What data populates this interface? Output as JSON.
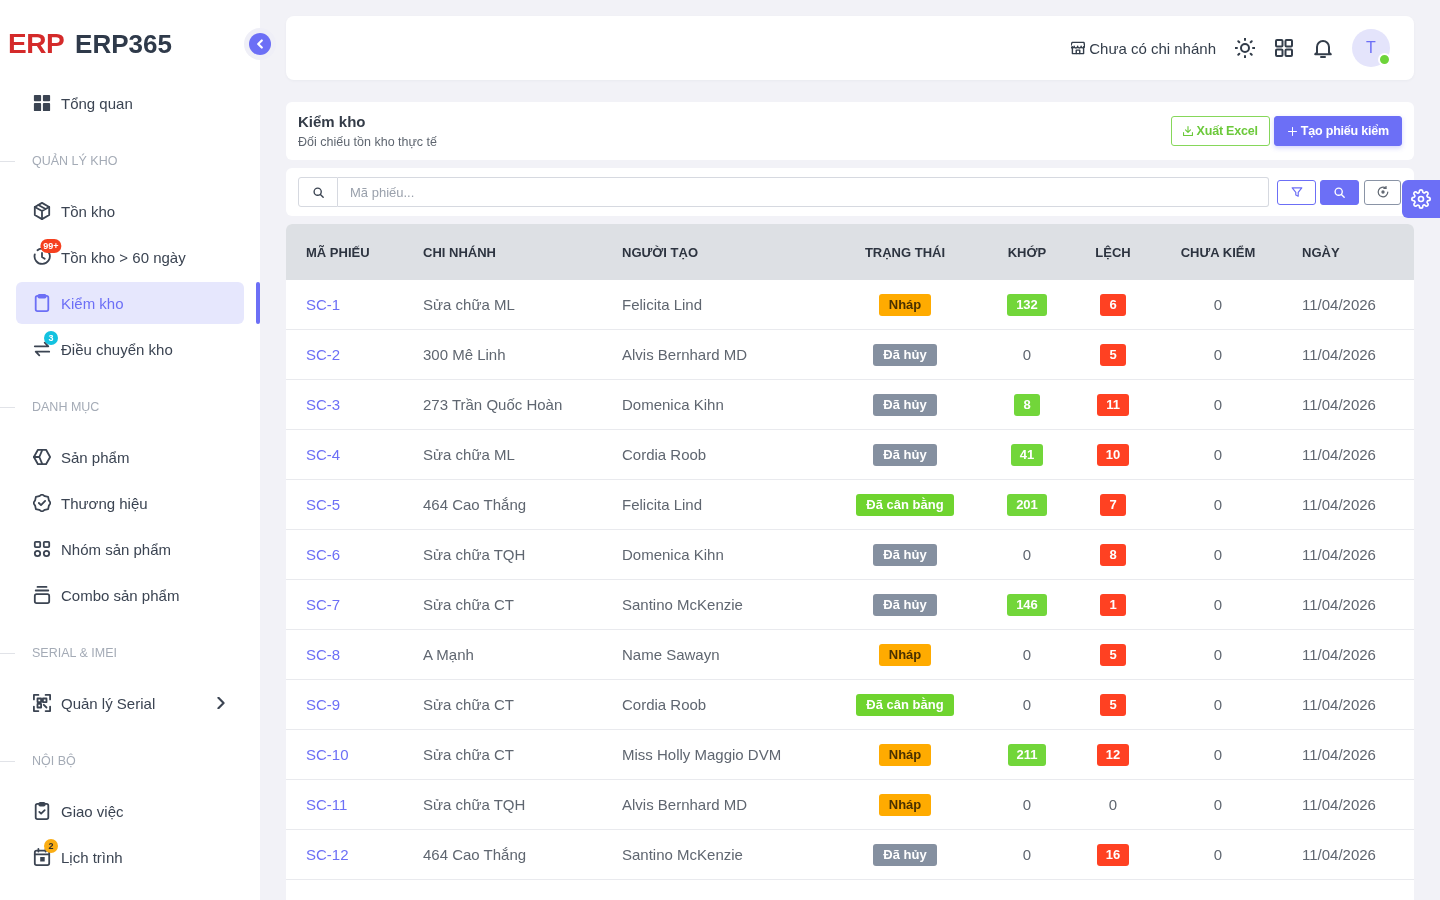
{
  "sidebar": {
    "logo": {
      "mark": "ERP",
      "name": "ERP365"
    },
    "sections": [
      {
        "items": [
          {
            "label": "Tổng quan",
            "selected": false
          }
        ]
      },
      {
        "title": "QUẢN LÝ KHO",
        "items": [
          {
            "label": "Tồn kho",
            "selected": false
          },
          {
            "label": "Tồn kho > 60 ngày",
            "selected": false,
            "badge": {
              "text": "99+",
              "color": "#f5401f"
            }
          },
          {
            "label": "Kiểm kho",
            "selected": true
          },
          {
            "label": "Điều chuyển kho",
            "selected": false,
            "badge": {
              "text": "3",
              "color": "#13c2e0"
            }
          }
        ]
      },
      {
        "title": "DANH MỤC",
        "items": [
          {
            "label": "Sản phẩm",
            "selected": false
          },
          {
            "label": "Thương hiệu",
            "selected": false
          },
          {
            "label": "Nhóm sản phẩm",
            "selected": false
          },
          {
            "label": "Combo sản phẩm",
            "selected": false
          }
        ]
      },
      {
        "title": "SERIAL & IMEI",
        "items": [
          {
            "label": "Quản lý Serial",
            "selected": false,
            "expanded": false
          }
        ]
      },
      {
        "title": "NỘI BỘ",
        "items": [
          {
            "label": "Giao việc",
            "selected": false
          },
          {
            "label": "Lịch trình",
            "selected": false,
            "badge": {
              "text": "2",
              "color": "#faad14"
            }
          }
        ]
      }
    ]
  },
  "header": {
    "branch": "Chưa có chi nhánh",
    "avatar": {
      "initial": "T",
      "online": true
    }
  },
  "page": {
    "title": "Kiểm kho",
    "subtitle": "Đối chiếu tồn kho thực tế",
    "actions": [
      {
        "label": "Xuất Excel",
        "kind": "outline"
      },
      {
        "label": "Tạo phiếu kiểm",
        "kind": "primary"
      }
    ]
  },
  "filters": {
    "search": {
      "placeholder": "Mã phiếu..."
    }
  },
  "table": {
    "columns": [
      "MÃ PHIẾU",
      "CHI NHÁNH",
      "NGƯỜI TẠO",
      "TRẠNG THÁI",
      "KHỚP",
      "LỆCH",
      "CHƯA KIỂM",
      "NGÀY"
    ],
    "rows": [
      {
        "code": "SC-1",
        "branch": "Sửa chữa ML",
        "creator": "Felicita Lind",
        "status": {
          "label": "Nháp",
          "kind": "draft"
        },
        "matched": {
          "text": "132",
          "highlighted": true
        },
        "variance": {
          "text": "6",
          "highlighted": true
        },
        "unchecked": "0",
        "date": "11/04/2026"
      },
      {
        "code": "SC-2",
        "branch": "300 Mê Linh",
        "creator": "Alvis Bernhard MD",
        "status": {
          "label": "Đã hủy",
          "kind": "cancelled"
        },
        "matched": {
          "text": "0",
          "highlighted": false
        },
        "variance": {
          "text": "5",
          "highlighted": true
        },
        "unchecked": "0",
        "date": "11/04/2026"
      },
      {
        "code": "SC-3",
        "branch": "273 Trần Quốc Hoàn",
        "creator": "Domenica Kihn",
        "status": {
          "label": "Đã hủy",
          "kind": "cancelled"
        },
        "matched": {
          "text": "8",
          "highlighted": true
        },
        "variance": {
          "text": "11",
          "highlighted": true
        },
        "unchecked": "0",
        "date": "11/04/2026"
      },
      {
        "code": "SC-4",
        "branch": "Sửa chữa ML",
        "creator": "Cordia Roob",
        "status": {
          "label": "Đã hủy",
          "kind": "cancelled"
        },
        "matched": {
          "text": "41",
          "highlighted": true
        },
        "variance": {
          "text": "10",
          "highlighted": true
        },
        "unchecked": "0",
        "date": "11/04/2026"
      },
      {
        "code": "SC-5",
        "branch": "464 Cao Thắng",
        "creator": "Felicita Lind",
        "status": {
          "label": "Đã cân bằng",
          "kind": "balanced"
        },
        "matched": {
          "text": "201",
          "highlighted": true
        },
        "variance": {
          "text": "7",
          "highlighted": true
        },
        "unchecked": "0",
        "date": "11/04/2026"
      },
      {
        "code": "SC-6",
        "branch": "Sửa chữa TQH",
        "creator": "Domenica Kihn",
        "status": {
          "label": "Đã hủy",
          "kind": "cancelled"
        },
        "matched": {
          "text": "0",
          "highlighted": false
        },
        "variance": {
          "text": "8",
          "highlighted": true
        },
        "unchecked": "0",
        "date": "11/04/2026"
      },
      {
        "code": "SC-7",
        "branch": "Sửa chữa CT",
        "creator": "Santino McKenzie",
        "status": {
          "label": "Đã hủy",
          "kind": "cancelled"
        },
        "matched": {
          "text": "146",
          "highlighted": true
        },
        "variance": {
          "text": "1",
          "highlighted": true
        },
        "unchecked": "0",
        "date": "11/04/2026"
      },
      {
        "code": "SC-8",
        "branch": "A Mạnh",
        "creator": "Name Sawayn",
        "status": {
          "label": "Nháp",
          "kind": "draft"
        },
        "matched": {
          "text": "0",
          "highlighted": false
        },
        "variance": {
          "text": "5",
          "highlighted": true
        },
        "unchecked": "0",
        "date": "11/04/2026"
      },
      {
        "code": "SC-9",
        "branch": "Sửa chữa CT",
        "creator": "Cordia Roob",
        "status": {
          "label": "Đã cân bằng",
          "kind": "balanced"
        },
        "matched": {
          "text": "0",
          "highlighted": false
        },
        "variance": {
          "text": "5",
          "highlighted": true
        },
        "unchecked": "0",
        "date": "11/04/2026"
      },
      {
        "code": "SC-10",
        "branch": "Sửa chữa CT",
        "creator": "Miss Holly Maggio DVM",
        "status": {
          "label": "Nháp",
          "kind": "draft"
        },
        "matched": {
          "text": "211",
          "highlighted": true
        },
        "variance": {
          "text": "12",
          "highlighted": true
        },
        "unchecked": "0",
        "date": "11/04/2026"
      },
      {
        "code": "SC-11",
        "branch": "Sửa chữa TQH",
        "creator": "Alvis Bernhard MD",
        "status": {
          "label": "Nháp",
          "kind": "draft"
        },
        "matched": {
          "text": "0",
          "highlighted": false
        },
        "variance": {
          "text": "0",
          "highlighted": false
        },
        "unchecked": "0",
        "date": "11/04/2026"
      },
      {
        "code": "SC-12",
        "branch": "464 Cao Thắng",
        "creator": "Santino McKenzie",
        "status": {
          "label": "Đã hủy",
          "kind": "cancelled"
        },
        "matched": {
          "text": "0",
          "highlighted": false
        },
        "variance": {
          "text": "16",
          "highlighted": true
        },
        "unchecked": "0",
        "date": "11/04/2026"
      }
    ]
  }
}
